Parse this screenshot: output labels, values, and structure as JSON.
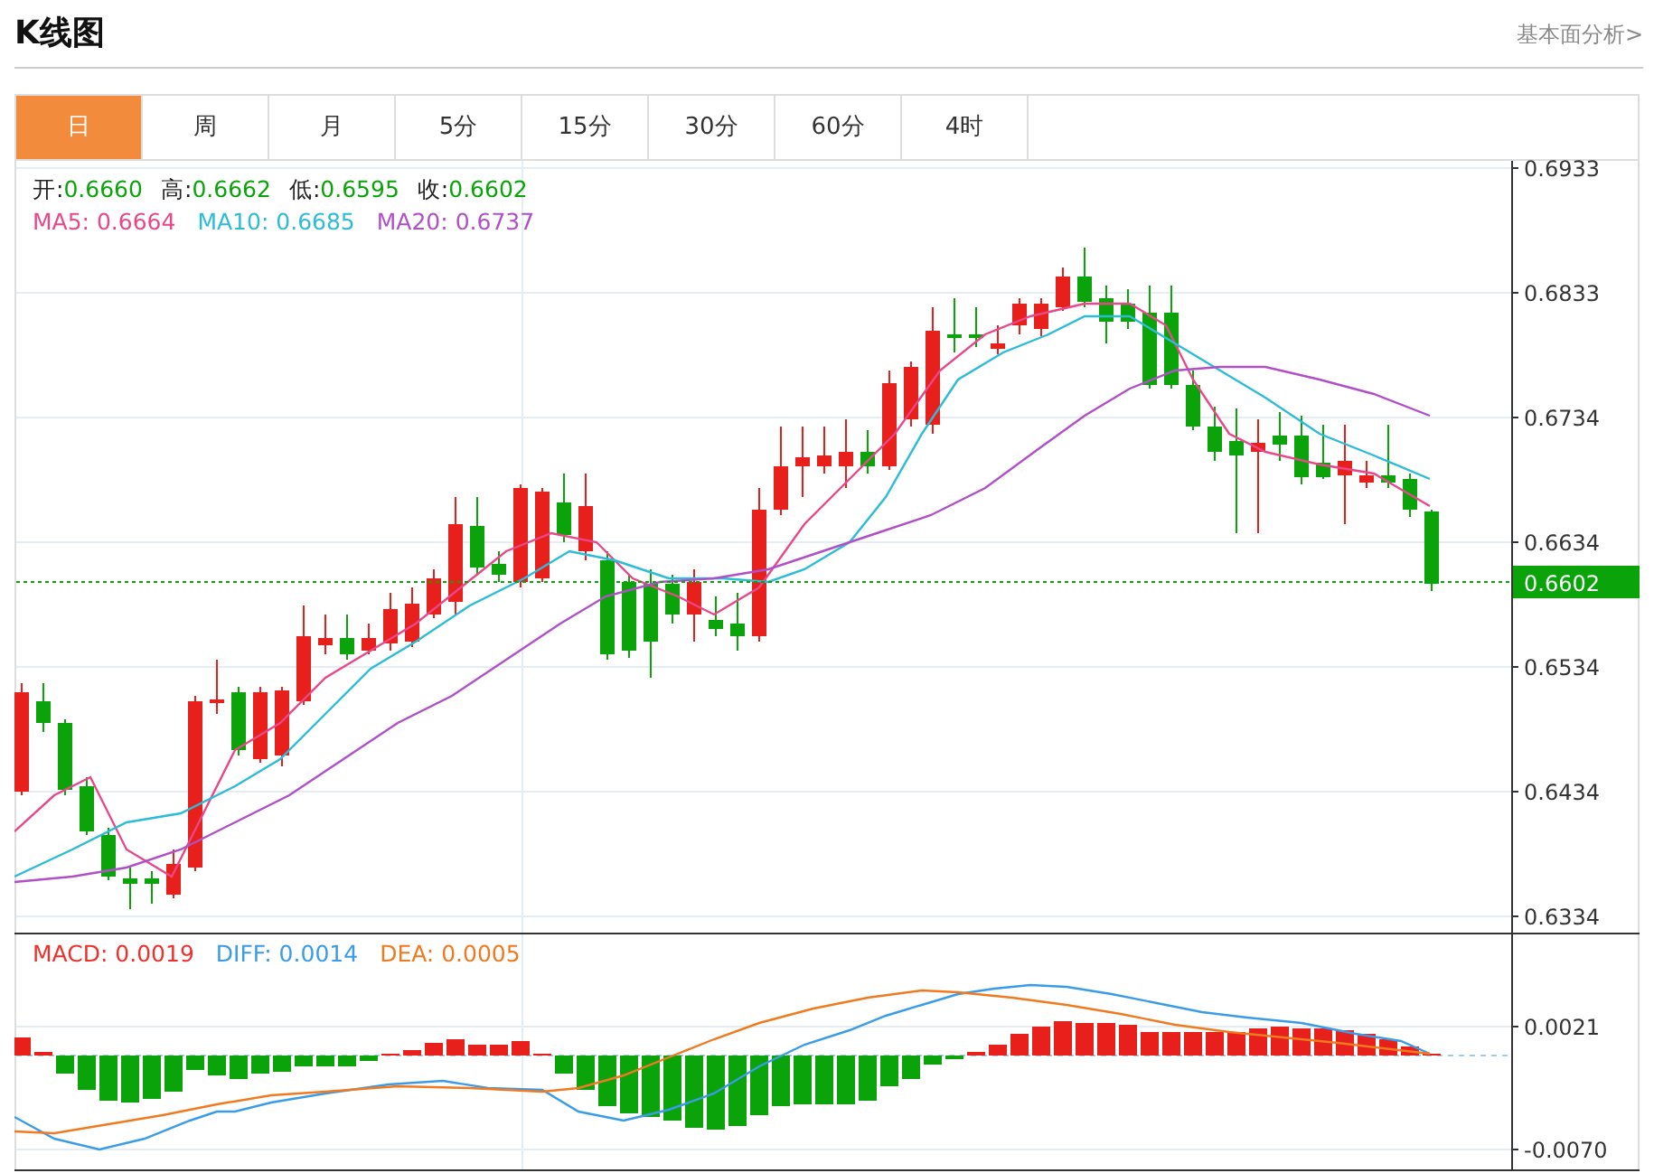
{
  "header": {
    "title": "K线图",
    "link": "基本面分析>"
  },
  "tabs": [
    {
      "label": "日",
      "selected": true
    },
    {
      "label": "周",
      "selected": false
    },
    {
      "label": "月",
      "selected": false
    },
    {
      "label": "5分",
      "selected": false
    },
    {
      "label": "15分",
      "selected": false
    },
    {
      "label": "30分",
      "selected": false
    },
    {
      "label": "60分",
      "selected": false
    },
    {
      "label": "4时",
      "selected": false
    }
  ],
  "price_legend": [
    {
      "label": "开:",
      "value": "0.6660"
    },
    {
      "label": "高:",
      "value": "0.6662"
    },
    {
      "label": "低:",
      "value": "0.6595"
    },
    {
      "label": "收:",
      "value": "0.6602"
    }
  ],
  "ma_legend": [
    {
      "label": "MA5: 0.6664",
      "color": "#e8488a"
    },
    {
      "label": "MA10: 0.6685",
      "color": "#2bbcd8"
    },
    {
      "label": "MA20: 0.6737",
      "color": "#b050c8"
    }
  ],
  "price_axis": [
    "0.6933",
    "0.6833",
    "0.6734",
    "0.6634",
    "0.6534",
    "0.6434",
    "0.6334"
  ],
  "current_price": "0.6602",
  "macd_legend": [
    {
      "label": "MACD: 0.0019",
      "color": "#f0302c"
    },
    {
      "label": "DIFF: 0.0014",
      "color": "#3a9be8"
    },
    {
      "label": "DEA: 0.0005",
      "color": "#f07a20"
    }
  ],
  "macd_axis": [
    "0.0021",
    "-0.0070"
  ]
}
